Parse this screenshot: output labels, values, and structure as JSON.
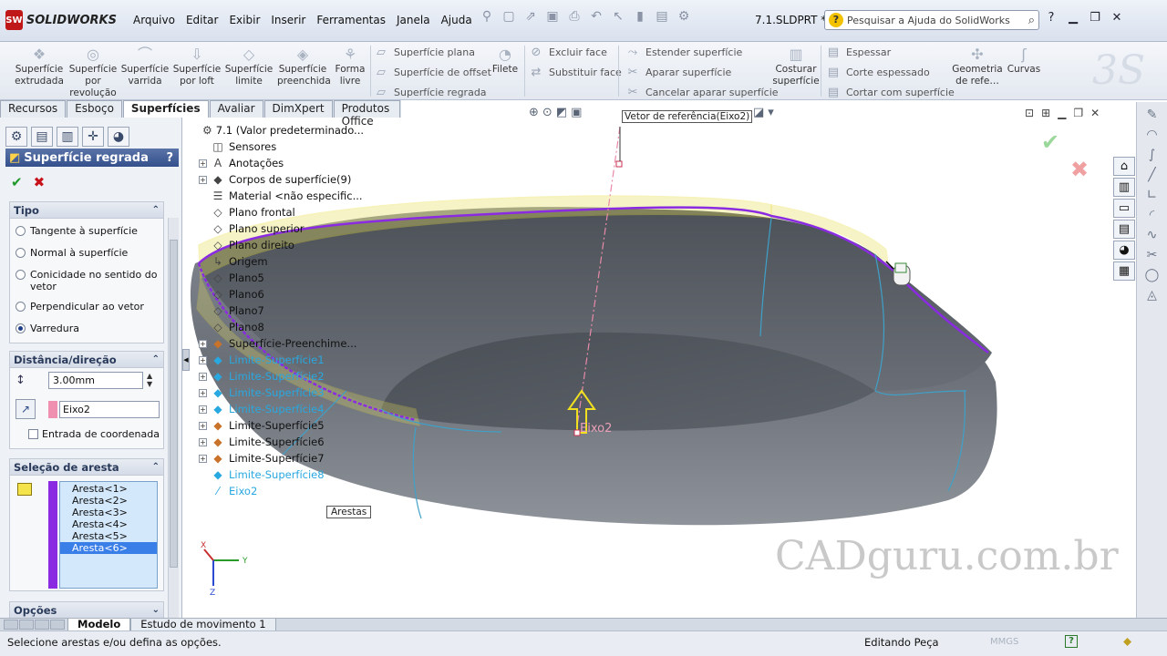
{
  "app": {
    "brand": "SOLIDWORKS",
    "brand_badge": "SW",
    "document_title": "7.1.SLDPRT *"
  },
  "menu": [
    "Arquivo",
    "Editar",
    "Exibir",
    "Inserir",
    "Ferramentas",
    "Janela",
    "Ajuda"
  ],
  "search": {
    "placeholder": "Pesquisar a Ajuda do SolidWorks",
    "help_glyph": "?"
  },
  "command_manager": {
    "big_buttons": [
      {
        "label": "Superfície extrudada",
        "icon": "extruded-surface-icon"
      },
      {
        "label": "Superfície por revolução",
        "icon": "revolved-surface-icon"
      },
      {
        "label": "Superfície varrida",
        "icon": "swept-surface-icon"
      },
      {
        "label": "Superfície por loft",
        "icon": "lofted-surface-icon"
      },
      {
        "label": "Superfície limite",
        "icon": "boundary-surface-icon"
      },
      {
        "label": "Superfície preenchida",
        "icon": "filled-surface-icon"
      },
      {
        "label": "Forma livre",
        "icon": "freeform-icon"
      }
    ],
    "col1": [
      "Superfície plana",
      "Superfície de offset",
      "Superfície regrada"
    ],
    "filete": "Filete",
    "col2": [
      "Excluir face",
      "Substituir face"
    ],
    "col3": [
      "Estender superfície",
      "Aparar superfície",
      "Cancelar aparar superfície"
    ],
    "costurar": "Costurar superfície",
    "col4": [
      "Espessar",
      "Corte espessado",
      "Cortar com superfície"
    ],
    "geometria": "Geometria de refe…",
    "curvas": "Curvas"
  },
  "tabs": [
    "Recursos",
    "Esboço",
    "Superfícies",
    "Avaliar",
    "DimXpert",
    "Produtos Office"
  ],
  "active_tab": "Superfícies",
  "property_manager": {
    "title": "Superfície regrada",
    "help": "?",
    "ok": "✔",
    "cancel": "✖",
    "tipo": {
      "header": "Tipo",
      "options": [
        "Tangente à superfície",
        "Normal à superfície",
        "Conicidade no sentido do vetor",
        "Perpendicular ao vetor",
        "Varredura"
      ],
      "selected": "Varredura"
    },
    "distancia": {
      "header": "Distância/direção",
      "distance": "3.00mm",
      "direction": "Eixo2",
      "checkbox": "Entrada de coordenada"
    },
    "selecao": {
      "header": "Seleção de aresta",
      "edges": [
        "Aresta<1>",
        "Aresta<2>",
        "Aresta<3>",
        "Aresta<4>",
        "Aresta<5>",
        "Aresta<6>"
      ],
      "selected": "Aresta<6>"
    },
    "opcoes": {
      "header": "Opções"
    }
  },
  "feature_tree": [
    {
      "label": "7.1  (Valor predeterminado...",
      "expand": false,
      "highlight": false
    },
    {
      "label": "Sensores",
      "expand": false,
      "highlight": false
    },
    {
      "label": "Anotações",
      "expand": true,
      "highlight": false
    },
    {
      "label": "Corpos de superfície(9)",
      "expand": true,
      "highlight": false
    },
    {
      "label": "Material <não especific...",
      "expand": false,
      "highlight": false
    },
    {
      "label": "Plano frontal",
      "expand": false,
      "highlight": false
    },
    {
      "label": "Plano superior",
      "expand": false,
      "highlight": false
    },
    {
      "label": "Plano direito",
      "expand": false,
      "highlight": false
    },
    {
      "label": "Origem",
      "expand": false,
      "highlight": false
    },
    {
      "label": "Plano5",
      "expand": false,
      "highlight": false
    },
    {
      "label": "Plano6",
      "expand": false,
      "highlight": false
    },
    {
      "label": "Plano7",
      "expand": false,
      "highlight": false
    },
    {
      "label": "Plano8",
      "expand": false,
      "highlight": false
    },
    {
      "label": "Superfície-Preenchime...",
      "expand": true,
      "highlight": false
    },
    {
      "label": "Limite-Superfície1",
      "expand": true,
      "highlight": true
    },
    {
      "label": "Limite-Superfície2",
      "expand": true,
      "highlight": true
    },
    {
      "label": "Limite-Superfície3",
      "expand": true,
      "highlight": true
    },
    {
      "label": "Limite-Superfície4",
      "expand": true,
      "highlight": true
    },
    {
      "label": "Limite-Superfície5",
      "expand": true,
      "highlight": false
    },
    {
      "label": "Limite-Superfície6",
      "expand": true,
      "highlight": false
    },
    {
      "label": "Limite-Superfície7",
      "expand": true,
      "highlight": false
    },
    {
      "label": "Limite-Superfície8",
      "expand": false,
      "highlight": true
    },
    {
      "label": "Eixo2",
      "expand": false,
      "highlight": true
    }
  ],
  "viewport": {
    "vector_callout": "Vetor de referência(Eixo2)",
    "axis_label": "Eixo2",
    "edges_callout": "Arestas",
    "watermark": "CADguru.com.br",
    "triad": {
      "x": "X",
      "y": "Y",
      "z": "Z"
    }
  },
  "bottom_tabs": [
    "Modelo",
    "Estudo de movimento 1"
  ],
  "status": {
    "message": "Selecione arestas e/ou defina as opções.",
    "mode": "Editando Peça",
    "units": "MMGS",
    "help": "?"
  },
  "colors": {
    "accent_purple": "#8a2be2",
    "highlight_cyan": "#28a8e0",
    "ok_green": "#1f9a2a",
    "cancel_red": "#c8121b",
    "surface_gray": "#6f747c",
    "preview_yellow": "#e8e060"
  }
}
